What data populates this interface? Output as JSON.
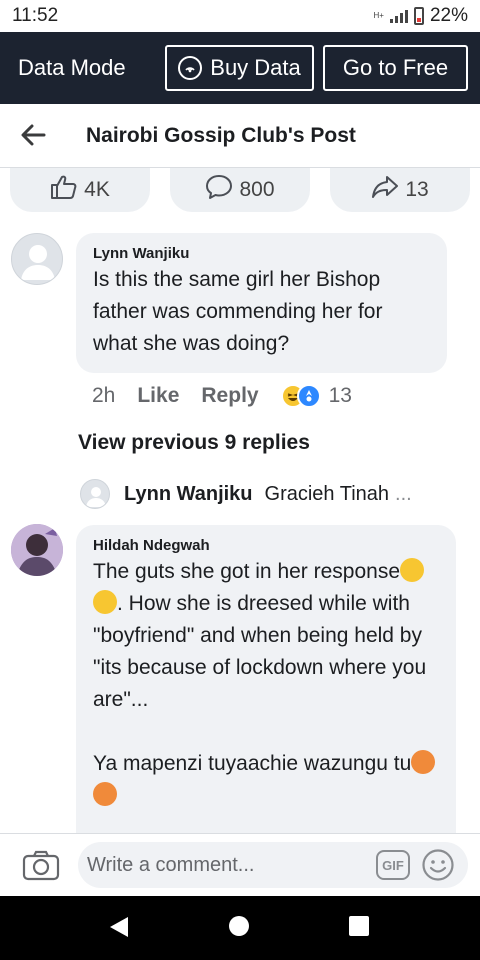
{
  "status_bar": {
    "time": "11:52",
    "battery": "22%",
    "network": "H+"
  },
  "data_bar": {
    "mode_label": "Data Mode",
    "buy_label": "Buy Data",
    "free_label": "Go to Free"
  },
  "header": {
    "title": "Nairobi Gossip Club's Post"
  },
  "post_stats": {
    "likes": "4K",
    "comments": "800",
    "shares": "13"
  },
  "comments": [
    {
      "author": "Lynn Wanjiku",
      "text": "Is this the same girl her Bishop father was commending her for what she was doing?",
      "time": "2h",
      "like_label": "Like",
      "reply_label": "Reply",
      "reaction_count": "13"
    },
    {
      "author": "Hildah Ndegwah",
      "text_part1": "The guts she got in her response",
      "text_part2": ". How she is dreesed while with \"boyfriend\" and when being held by \"its because of lockdown where you are\"...",
      "text_part3": "Ya mapenzi tuyaachie wazungu tu"
    }
  ],
  "replies": {
    "view_previous": "View previous 9 replies",
    "latest_author": "Lynn Wanjiku",
    "latest_text": "Gracieh Tinah",
    "more": "..."
  },
  "composer": {
    "placeholder": "Write a comment...",
    "gif_label": "GIF"
  },
  "icons": {
    "back": "arrow-left-icon",
    "like": "thumbs-up-icon",
    "comment": "speech-bubble-icon",
    "share": "share-arrow-icon",
    "camera": "camera-icon",
    "smiley": "smiley-icon"
  },
  "colors": {
    "data_bar_bg": "#1c2330",
    "bubble_bg": "#f0f2f5",
    "pill_bg": "#edf0f3",
    "text": "#1c1e21",
    "meta": "#65676b"
  }
}
